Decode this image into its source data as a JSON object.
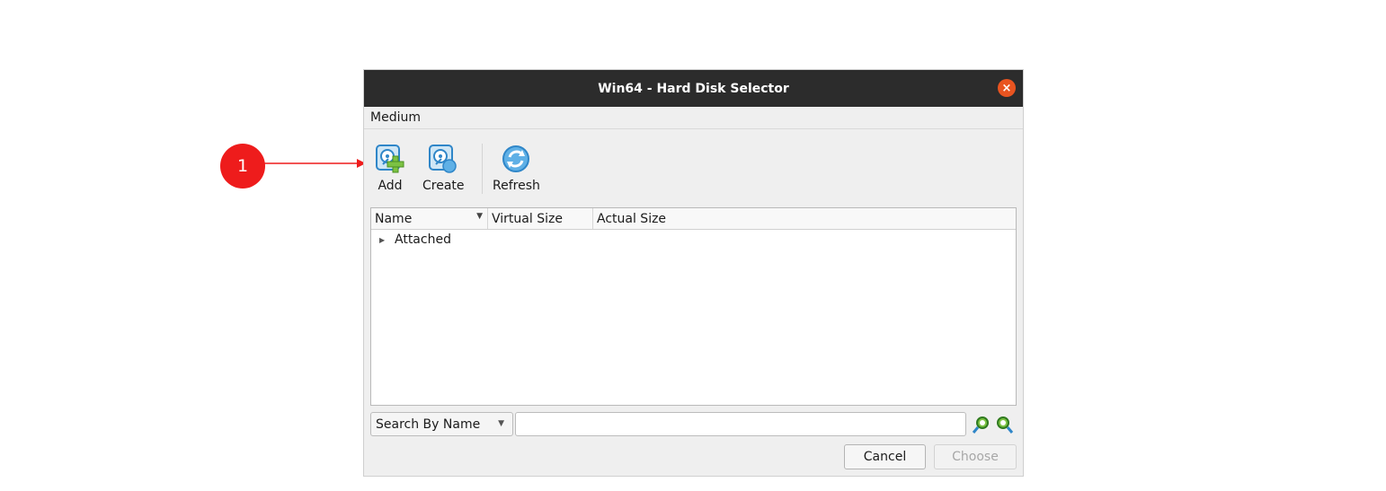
{
  "annotation": {
    "number": "1"
  },
  "window": {
    "title": "Win64 - Hard Disk Selector",
    "close_glyph": "×"
  },
  "menu": {
    "items": [
      "Medium"
    ]
  },
  "toolbar": {
    "add": {
      "label": "Add",
      "icon": "harddisk-add-icon"
    },
    "create": {
      "label": "Create",
      "icon": "harddisk-create-icon"
    },
    "refresh": {
      "label": "Refresh",
      "icon": "refresh-icon"
    }
  },
  "table": {
    "columns": [
      "Name",
      "Virtual Size",
      "Actual Size"
    ],
    "rows": [
      {
        "label": "Attached",
        "expanded": false
      }
    ]
  },
  "search": {
    "mode": "Search By Name",
    "value": "",
    "placeholder": ""
  },
  "buttons": {
    "cancel": "Cancel",
    "choose": "Choose"
  },
  "colors": {
    "titlebar": "#2c2c2c",
    "close_button": "#e95420",
    "annotation": "#ee1c1c",
    "icon_blue": "#2f86c8",
    "icon_green": "#7cc243"
  }
}
